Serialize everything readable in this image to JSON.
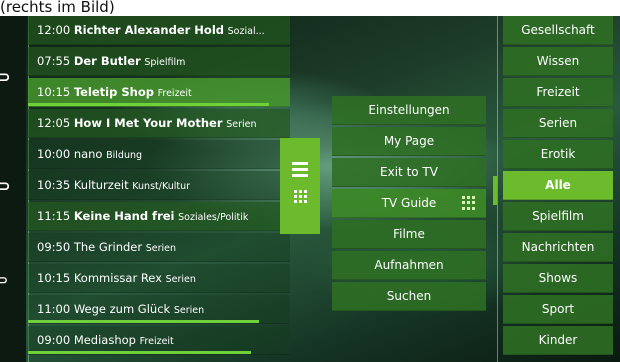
{
  "caption": "(rechts im Bild)",
  "channel_list": [
    {
      "time": "12:00",
      "title": "Richter Alexander Hold",
      "genre": "Sozial...",
      "style": "normal",
      "progress": 0
    },
    {
      "time": "07:55",
      "title": "Der Butler",
      "genre": "Spielfilm",
      "style": "normal",
      "progress": 0
    },
    {
      "time": "10:15",
      "title": "Teletip Shop",
      "genre": "Freizeit",
      "style": "bright",
      "progress": 0.92
    },
    {
      "time": "12:05",
      "title": "How I Met Your Mother",
      "genre": "Serien",
      "style": "normal",
      "progress": 0
    },
    {
      "time": "10:00",
      "title": "nano",
      "genre": "Bildung",
      "style": "dim",
      "progress": 0
    },
    {
      "time": "10:35",
      "title": "Kulturzeit",
      "genre": "Kunst/Kultur",
      "style": "dim",
      "progress": 0
    },
    {
      "time": "11:15",
      "title": "Keine Hand frei",
      "genre": "Soziales/Politik",
      "style": "normal",
      "progress": 0
    },
    {
      "time": "09:50",
      "title": "The Grinder",
      "genre": "Serien",
      "style": "dim",
      "progress": 0
    },
    {
      "time": "10:15",
      "title": "Kommissar Rex",
      "genre": "Serien",
      "style": "dim",
      "progress": 0
    },
    {
      "time": "11:00",
      "title": "Wege zum Glück",
      "genre": "Serien",
      "style": "dim",
      "progress": 0.88
    },
    {
      "time": "09:00",
      "title": "Mediashop",
      "genre": "Freizeit",
      "style": "dim",
      "progress": 0.85
    }
  ],
  "main_menu": [
    {
      "label": "Einstellungen"
    },
    {
      "label": "My Page"
    },
    {
      "label": "Exit to TV"
    },
    {
      "label": "TV Guide",
      "active": true,
      "icon": "grid-icon"
    },
    {
      "label": "Filme"
    },
    {
      "label": "Aufnahmen"
    },
    {
      "label": "Suchen"
    }
  ],
  "categories": [
    {
      "label": "Gesellschaft"
    },
    {
      "label": "Wissen"
    },
    {
      "label": "Freizeit"
    },
    {
      "label": "Serien"
    },
    {
      "label": "Erotik"
    },
    {
      "label": "Alle",
      "active": true
    },
    {
      "label": "Spielfilm"
    },
    {
      "label": "Nachrichten"
    },
    {
      "label": "Shows"
    },
    {
      "label": "Sport"
    },
    {
      "label": "Kinder"
    }
  ],
  "center_tab": {
    "icons": [
      "list-icon",
      "grid-icon"
    ]
  },
  "colors": {
    "accent": "#6bbb2c",
    "row_green": "#23581e",
    "progress": "#6fd03a",
    "background_dark": "#0c1e14"
  }
}
